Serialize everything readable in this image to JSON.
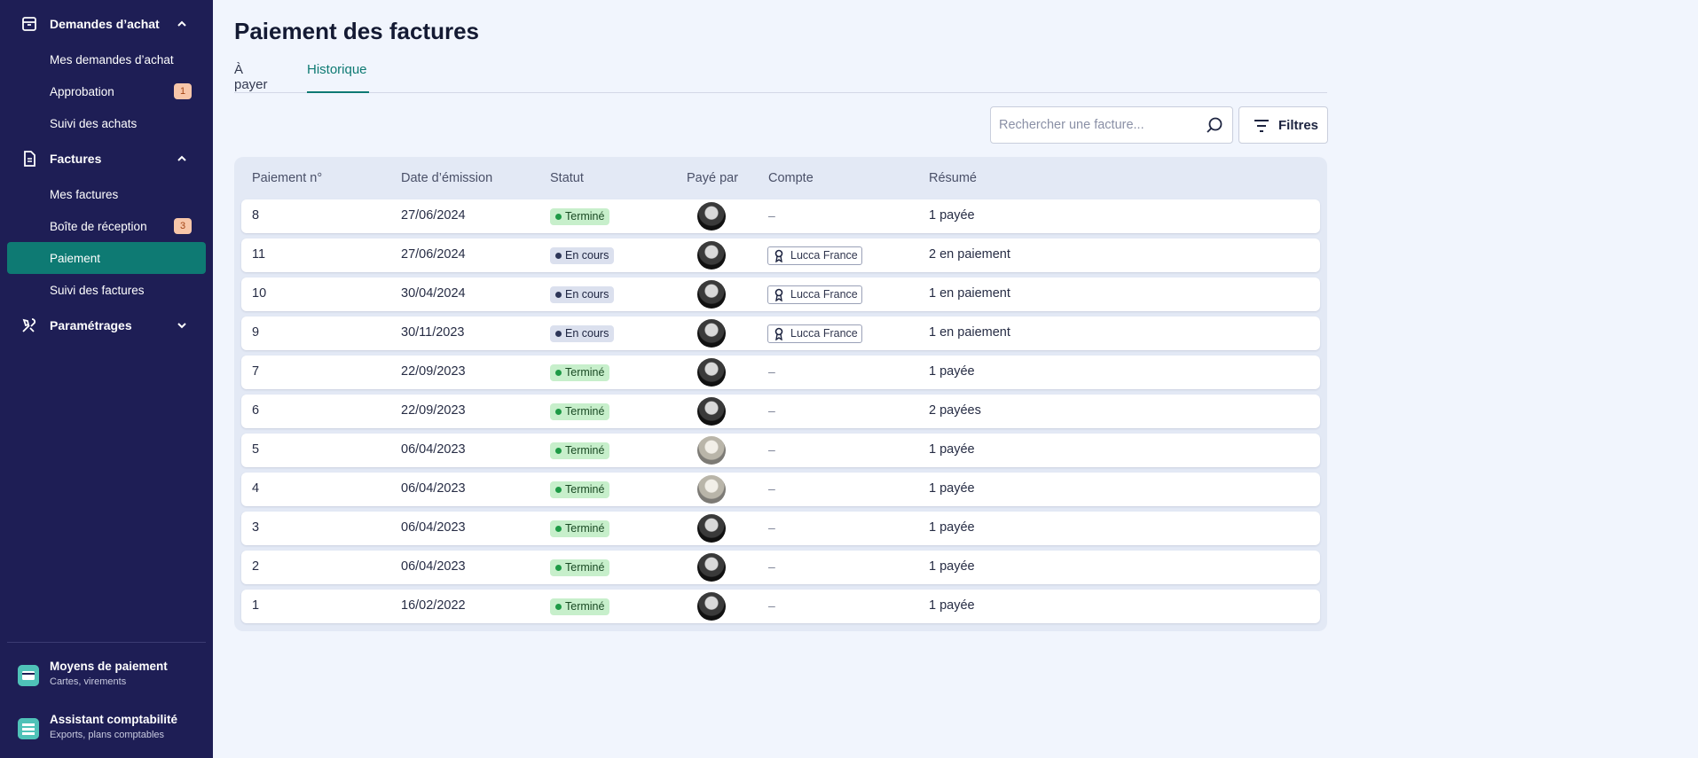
{
  "sidebar": {
    "sections": [
      {
        "label": "Demandes d’achat",
        "icon": "archive-icon",
        "expanded": true
      },
      {
        "label": "Factures",
        "icon": "invoice-icon",
        "expanded": true
      },
      {
        "label": "Paramétrages",
        "icon": "tools-icon",
        "expanded": false
      }
    ],
    "items": [
      {
        "label": "Mes demandes d’achat"
      },
      {
        "label": "Approbation",
        "badge": "1"
      },
      {
        "label": "Suivi des achats"
      },
      {
        "label": "Mes factures"
      },
      {
        "label": "Boîte de réception",
        "badge": "3"
      },
      {
        "label": "Paiement",
        "active": true
      },
      {
        "label": "Suivi des factures"
      }
    ],
    "bottom": [
      {
        "title": "Moyens de paiement",
        "subtitle": "Cartes, virements",
        "icon": "payment-card-icon"
      },
      {
        "title": "Assistant comptabilité",
        "subtitle": "Exports, plans comptables",
        "icon": "accounting-icon"
      }
    ]
  },
  "page": {
    "title": "Paiement des factures",
    "tabs": [
      {
        "label": "À payer",
        "active": false
      },
      {
        "label": "Historique",
        "active": true
      }
    ]
  },
  "search": {
    "placeholder": "Rechercher une facture...",
    "value": ""
  },
  "filters": {
    "label": "Filtres"
  },
  "table": {
    "headers": [
      "Paiement n°",
      "Date d’émission",
      "Statut",
      "Payé par",
      "Compte",
      "Résumé"
    ],
    "rows": [
      {
        "id": "8",
        "date": "27/06/2024",
        "status": "Terminé",
        "status_kind": "done",
        "account": "–",
        "summary": "1 payée"
      },
      {
        "id": "11",
        "date": "27/06/2024",
        "status": "En cours",
        "status_kind": "progress",
        "account": "Lucca France",
        "summary": "2 en paiement"
      },
      {
        "id": "10",
        "date": "30/04/2024",
        "status": "En cours",
        "status_kind": "progress",
        "account": "Lucca France",
        "summary": "1 en paiement"
      },
      {
        "id": "9",
        "date": "30/11/2023",
        "status": "En cours",
        "status_kind": "progress",
        "account": "Lucca France",
        "summary": "1 en paiement"
      },
      {
        "id": "7",
        "date": "22/09/2023",
        "status": "Terminé",
        "status_kind": "done",
        "account": "–",
        "summary": "1 payée"
      },
      {
        "id": "6",
        "date": "22/09/2023",
        "status": "Terminé",
        "status_kind": "done",
        "account": "–",
        "summary": "2 payées"
      },
      {
        "id": "5",
        "date": "06/04/2023",
        "status": "Terminé",
        "status_kind": "done",
        "account": "–",
        "summary": "1 payée"
      },
      {
        "id": "4",
        "date": "06/04/2023",
        "status": "Terminé",
        "status_kind": "done",
        "account": "–",
        "summary": "1 payée"
      },
      {
        "id": "3",
        "date": "06/04/2023",
        "status": "Terminé",
        "status_kind": "done",
        "account": "–",
        "summary": "1 payée"
      },
      {
        "id": "2",
        "date": "06/04/2023",
        "status": "Terminé",
        "status_kind": "done",
        "account": "–",
        "summary": "1 payée"
      },
      {
        "id": "1",
        "date": "16/02/2022",
        "status": "Terminé",
        "status_kind": "done",
        "account": "–",
        "summary": "1 payée"
      }
    ]
  },
  "colors": {
    "sidebar_bg": "#1e1e55",
    "accent": "#0e7a73",
    "badge_bg": "#f7c6a9",
    "status_done": "#c7efcb",
    "status_progress": "#dbe0ee"
  }
}
